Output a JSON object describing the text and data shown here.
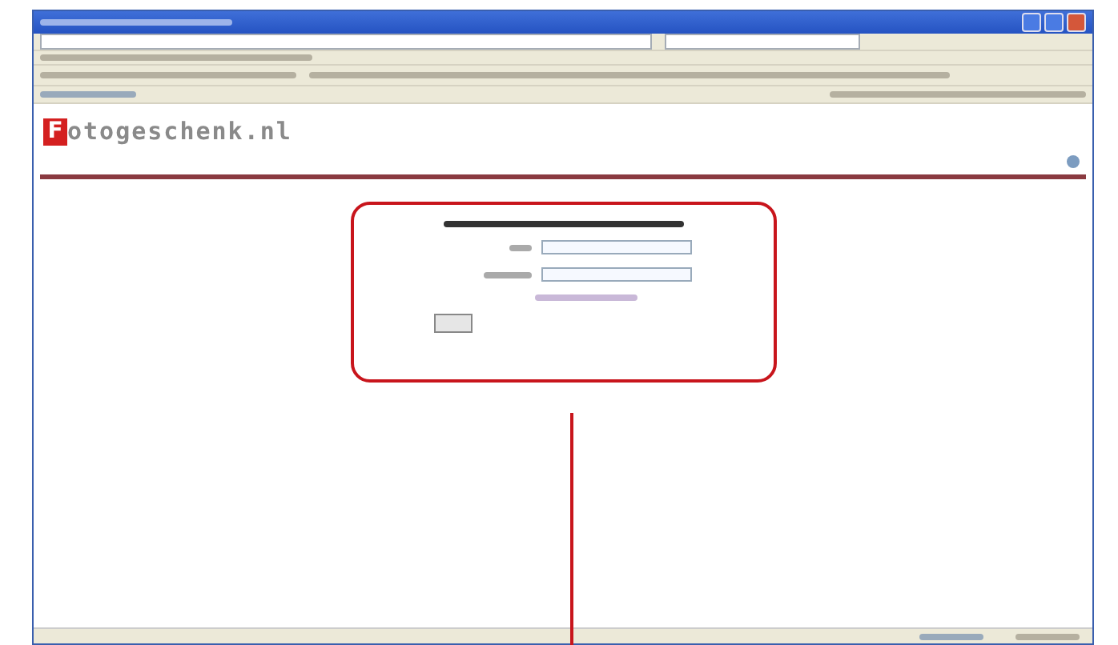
{
  "logo": {
    "initial": "F",
    "text": "otogeschenk.nl"
  }
}
